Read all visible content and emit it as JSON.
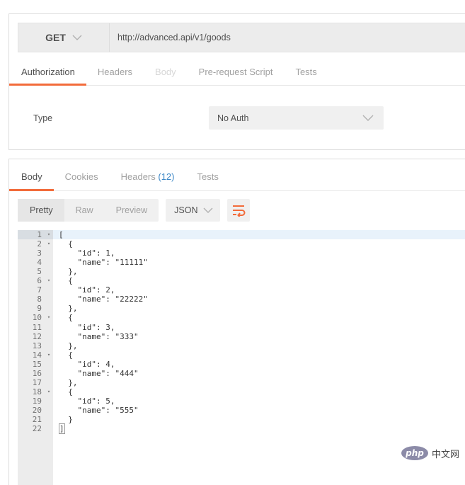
{
  "request": {
    "method": "GET",
    "url": "http://advanced.api/v1/goods",
    "tabs": [
      {
        "label": "Authorization"
      },
      {
        "label": "Headers"
      },
      {
        "label": "Body"
      },
      {
        "label": "Pre-request Script"
      },
      {
        "label": "Tests"
      }
    ],
    "auth": {
      "type_label": "Type",
      "selected": "No Auth"
    }
  },
  "response": {
    "tabs": [
      {
        "label": "Body"
      },
      {
        "label": "Cookies"
      },
      {
        "label": "Headers",
        "count": "(12)"
      },
      {
        "label": "Tests"
      }
    ],
    "formats": [
      {
        "label": "Pretty"
      },
      {
        "label": "Raw"
      },
      {
        "label": "Preview"
      }
    ],
    "language": "JSON",
    "code_lines": [
      {
        "n": "1",
        "fold": true,
        "text": "[",
        "current": true
      },
      {
        "n": "2",
        "fold": true,
        "text": "  {"
      },
      {
        "n": "3",
        "text": "    \"id\": 1,"
      },
      {
        "n": "4",
        "text": "    \"name\": \"11111\""
      },
      {
        "n": "5",
        "text": "  },"
      },
      {
        "n": "6",
        "fold": true,
        "text": "  {"
      },
      {
        "n": "7",
        "text": "    \"id\": 2,"
      },
      {
        "n": "8",
        "text": "    \"name\": \"22222\""
      },
      {
        "n": "9",
        "text": "  },"
      },
      {
        "n": "10",
        "fold": true,
        "text": "  {"
      },
      {
        "n": "11",
        "text": "    \"id\": 3,"
      },
      {
        "n": "12",
        "text": "    \"name\": \"333\""
      },
      {
        "n": "13",
        "text": "  },"
      },
      {
        "n": "14",
        "fold": true,
        "text": "  {"
      },
      {
        "n": "15",
        "text": "    \"id\": 4,"
      },
      {
        "n": "16",
        "text": "    \"name\": \"444\""
      },
      {
        "n": "17",
        "text": "  },"
      },
      {
        "n": "18",
        "fold": true,
        "text": "  {"
      },
      {
        "n": "19",
        "text": "    \"id\": 5,"
      },
      {
        "n": "20",
        "text": "    \"name\": \"555\""
      },
      {
        "n": "21",
        "text": "  }"
      },
      {
        "n": "22",
        "text": "]",
        "bracket": true
      }
    ]
  },
  "watermark": {
    "logo": "php",
    "text": "中文网"
  },
  "colors": {
    "accent": "#f26b3a",
    "count_blue": "#3d88c7"
  }
}
